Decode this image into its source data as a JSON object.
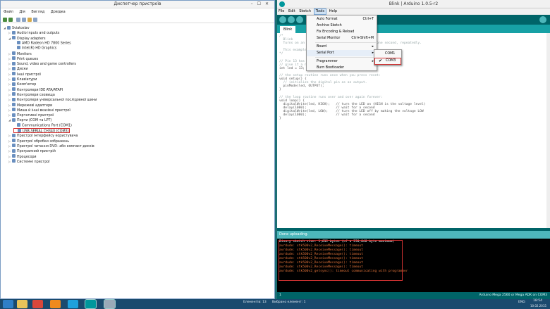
{
  "device_manager": {
    "title": "Диспетчер пристроїв",
    "menu": [
      "Файл",
      "Дія",
      "Вигляд",
      "Довідка"
    ],
    "tree": [
      {
        "label": "Sviatoslav",
        "level": 0,
        "expanded": true
      },
      {
        "label": "Audio inputs and outputs",
        "level": 1
      },
      {
        "label": "Display adapters",
        "level": 1,
        "expanded": true
      },
      {
        "label": "AMD Radeon HD 7800 Series",
        "level": 2
      },
      {
        "label": "Intel(R) HD Graphics",
        "level": 2
      },
      {
        "label": "Monitors",
        "level": 1
      },
      {
        "label": "Print queues",
        "level": 1
      },
      {
        "label": "Sound, video and game controllers",
        "level": 1
      },
      {
        "label": "Диски",
        "level": 1
      },
      {
        "label": "Інші пристрої",
        "level": 1
      },
      {
        "label": "Клавіатури",
        "level": 1
      },
      {
        "label": "Комп'ютер",
        "level": 1
      },
      {
        "label": "Контролери IDE ATA/ATAPI",
        "level": 1
      },
      {
        "label": "Контролери сховища",
        "level": 1
      },
      {
        "label": "Контролери універсальної послідовної шини",
        "level": 1
      },
      {
        "label": "Мережеві адаптери",
        "level": 1
      },
      {
        "label": "Миша й інші вказівні пристрої",
        "level": 1
      },
      {
        "label": "Портативні пристрої",
        "level": 1
      },
      {
        "label": "Порти (COM та LPT)",
        "level": 1,
        "expanded": true
      },
      {
        "label": "Communications Port (COM1)",
        "level": 2
      },
      {
        "label": "USB-SERIAL CH340 (COM3)",
        "level": 2,
        "highlighted": true
      },
      {
        "label": "Пристрої інтерфейсу користувача",
        "level": 1
      },
      {
        "label": "Пристрої обробки зображень",
        "level": 1
      },
      {
        "label": "Пристрої читання DVD- або компакт-дисків",
        "level": 1
      },
      {
        "label": "Програмний пристрій",
        "level": 1
      },
      {
        "label": "Процесори",
        "level": 1
      },
      {
        "label": "Системні пристрої",
        "level": 1
      }
    ]
  },
  "arduino": {
    "title": "Blink | Arduino 1.0.5-r2",
    "menu": [
      "File",
      "Edit",
      "Sketch",
      "Tools",
      "Help"
    ],
    "active_menu": "Tools",
    "tab": "Blink",
    "tools_menu": [
      {
        "label": "Auto Format",
        "shortcut": "Ctrl+T"
      },
      {
        "label": "Archive Sketch",
        "shortcut": ""
      },
      {
        "label": "Fix Encoding & Reload",
        "shortcut": ""
      },
      {
        "label": "Serial Monitor",
        "shortcut": "Ctrl+Shift+M"
      },
      {
        "label": "Board",
        "shortcut": "▸"
      },
      {
        "label": "Serial Port",
        "shortcut": "▸"
      },
      {
        "label": "Programmer",
        "shortcut": "▸"
      },
      {
        "label": "Burn Bootloader",
        "shortcut": ""
      }
    ],
    "serial_ports": [
      {
        "label": "COM1",
        "checked": false
      },
      {
        "label": "COM3",
        "checked": true
      }
    ],
    "code": [
      "/*",
      "  Blink",
      "  Turns on an LED on for one second, then off for one second, repeatedly.",
      "",
      "  This example code is in the public domain.",
      "*/",
      "",
      "// Pin 13 has an LED connected on most Arduino boards.",
      "// give it a name:",
      "int led = 13;",
      "",
      "// the setup routine runs once when you press reset:",
      "void setup() {",
      "  // initialize the digital pin as an output.",
      "  pinMode(led, OUTPUT);",
      "}",
      "",
      "// the loop routine runs over and over again forever:",
      "void loop() {",
      "  digitalWrite(led, HIGH);   // turn the LED on (HIGH is the voltage level)",
      "  delay(1000);               // wait for a second",
      "  digitalWrite(led, LOW);    // turn the LED off by making the voltage LOW",
      "  delay(1000);               // wait for a second",
      "}"
    ],
    "status": "Done uploading.",
    "console": [
      {
        "text": "Binary sketch size: 1,632 bytes (of a 258,048 byte maximum)",
        "type": "info"
      },
      {
        "text": "avrdude: stk500v2_ReceiveMessage(): timeout",
        "type": "error"
      },
      {
        "text": "avrdude: stk500v2_ReceiveMessage(): timeout",
        "type": "error"
      },
      {
        "text": "avrdude: stk500v2_ReceiveMessage(): timeout",
        "type": "error"
      },
      {
        "text": "avrdude: stk500v2_ReceiveMessage(): timeout",
        "type": "error"
      },
      {
        "text": "avrdude: stk500v2_ReceiveMessage(): timeout",
        "type": "error"
      },
      {
        "text": "avrdude: stk500v2_ReceiveMessage(): timeout",
        "type": "error"
      },
      {
        "text": "avrdude: stk500v2_getsync(): timeout communicating with programmer",
        "type": "error"
      }
    ],
    "board_status": "Arduino Mega 2560 or Mega ADK on COM3",
    "line_number": "1"
  },
  "taskbar": {
    "items": [
      "start-icon",
      "explorer-icon",
      "chrome-icon",
      "vlc-icon",
      "skype-icon",
      "arduino-icon",
      "device-manager-icon"
    ],
    "status_left": "Елементів: 13",
    "status_mid": "Вибрано елемент: 1",
    "lang": "ENG",
    "time": "18:54",
    "date": "10.02.2015"
  },
  "colors": {
    "arduino_teal": "#006468",
    "arduino_tab": "#17a1a5",
    "highlight_red": "#d43030",
    "error_orange": "#e2743a"
  }
}
